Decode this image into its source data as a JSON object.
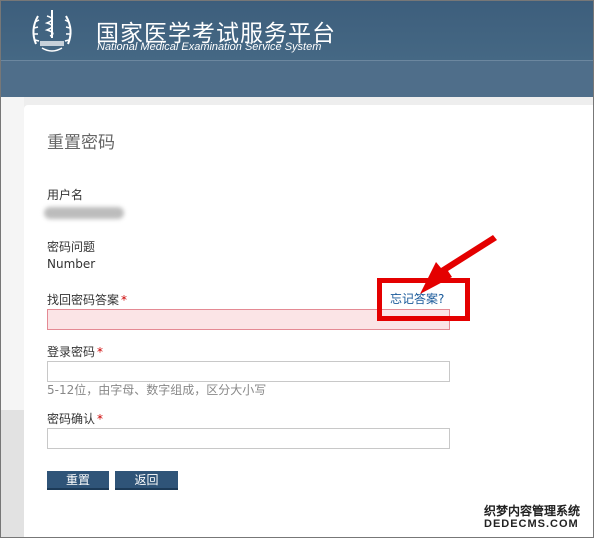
{
  "header": {
    "title": "国家医学考试服务平台",
    "subtitle": "National Medical Examination Service System"
  },
  "page": {
    "title": "重置密码"
  },
  "form": {
    "username_label": "用户名",
    "security_question_label": "密码问题",
    "security_question_value": "Number",
    "answer_label": "找回密码答案",
    "answer_value": "",
    "forgot_answer_link": "忘记答案?",
    "login_password_label": "登录密码",
    "login_password_value": "",
    "password_hint": "5-12位，由字母、数字组成，区分大小写",
    "confirm_label": "密码确认",
    "confirm_value": "",
    "required_mark": "*"
  },
  "buttons": {
    "reset": "重置",
    "back": "返回"
  },
  "watermark": {
    "cn": "织梦内容管理系统",
    "en": "DEDECMS.COM"
  },
  "colors": {
    "header": "#4b6a85",
    "button": "#2f5478",
    "highlight": "#e40000",
    "error_field": "#fbe4e6",
    "link": "#1a5a9a"
  }
}
